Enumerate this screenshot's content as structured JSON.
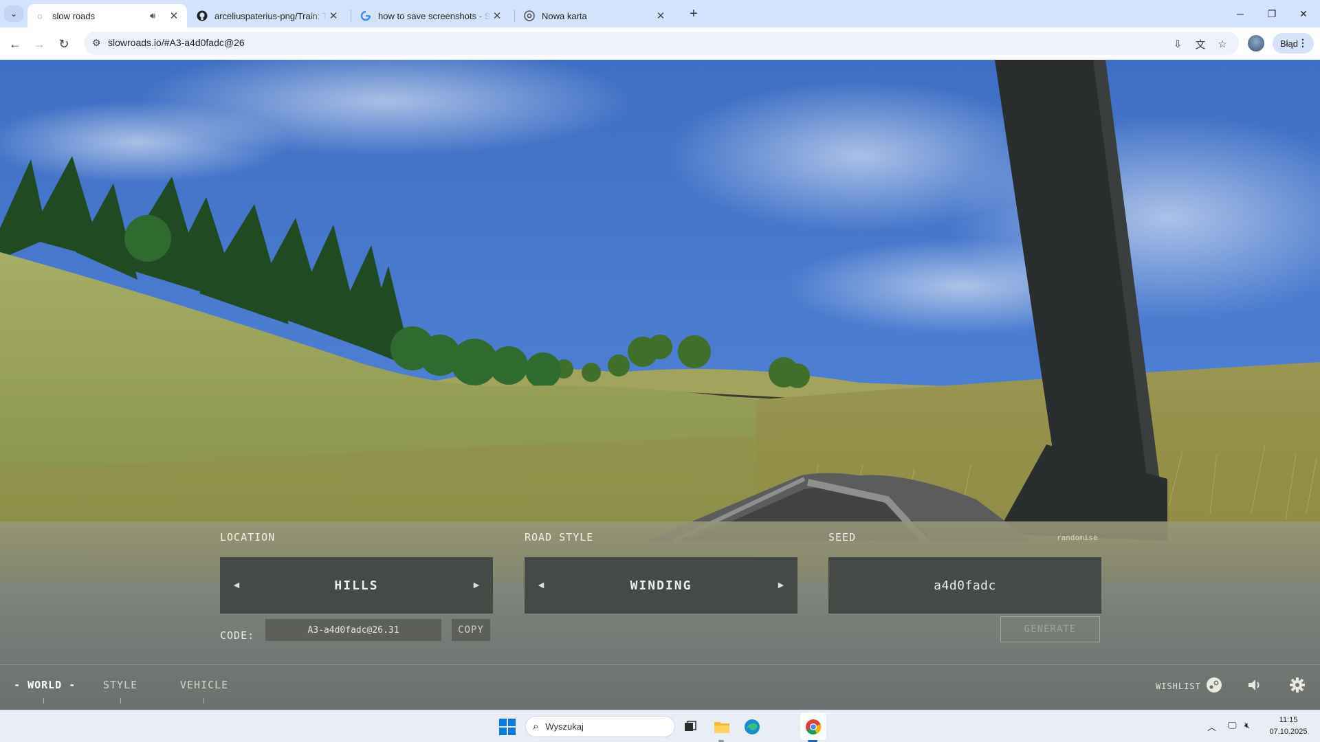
{
  "browser": {
    "tabs": [
      {
        "title": "slow roads",
        "icon": "globe-icon",
        "active": true,
        "audio": true
      },
      {
        "title": "arceliuspaterius-png/Train: TTT",
        "icon": "github-icon",
        "active": false
      },
      {
        "title": "how to save screenshots - Szuk",
        "icon": "google-icon",
        "active": false
      },
      {
        "title": "Nowa karta",
        "icon": "chrome-icon",
        "active": false
      }
    ],
    "address": "slowroads.io/#A3-a4d0fadc@26",
    "profile_status": "Błąd"
  },
  "game": {
    "location": {
      "label": "LOCATION",
      "value": "HILLS"
    },
    "road_style": {
      "label": "ROAD STYLE",
      "value": "WINDING"
    },
    "seed": {
      "label": "SEED",
      "value": "a4d0fadc",
      "randomise": "randomise"
    },
    "code": {
      "label": "CODE:",
      "value": "A3-a4d0fadc@26.31",
      "copy": "COPY"
    },
    "generate": "GENERATE",
    "nav": {
      "world": "WORLD",
      "style": "STYLE",
      "vehicle": "VEHICLE",
      "wishlist": "WISHLIST"
    },
    "colors": {
      "panel": "#7f8270",
      "selector_bg": "#454a47",
      "sky": "#4a78c9",
      "grass": "#8f9a4f"
    }
  },
  "taskbar": {
    "search_placeholder": "Wyszukaj",
    "time": "11:15",
    "date": "07.10.2025"
  }
}
